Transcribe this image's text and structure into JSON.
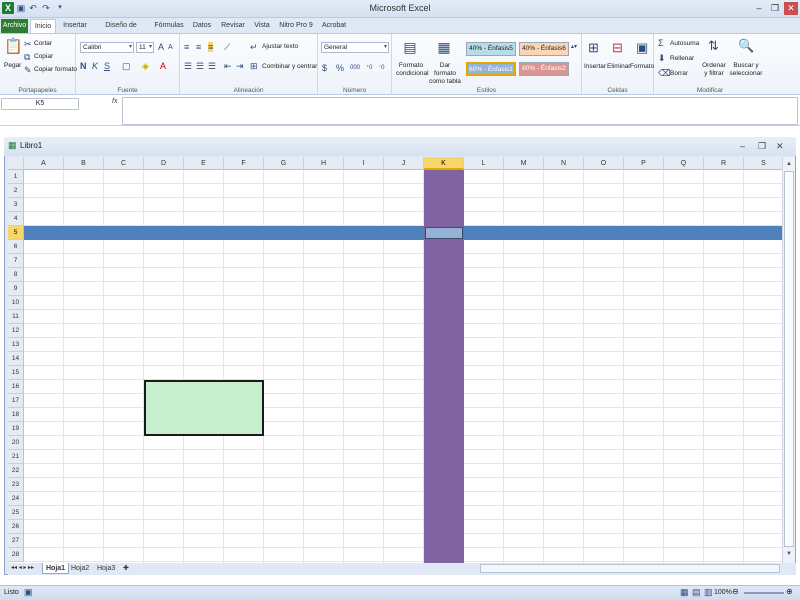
{
  "app": {
    "title": "Microsoft Excel"
  },
  "tabs": [
    "Archivo",
    "Inicio",
    "Insertar",
    "Diseño de página",
    "Fórmulas",
    "Datos",
    "Revisar",
    "Vista",
    "Nitro Pro 9",
    "Acrobat"
  ],
  "ribbon": {
    "clipboard": {
      "paste": "Pegar",
      "cut": "Cortar",
      "copy": "Copiar",
      "format_painter": "Copiar formato",
      "label": "Portapapeles"
    },
    "font": {
      "name": "Calibri",
      "size": "11",
      "label": "Fuente"
    },
    "alignment": {
      "wrap": "Ajustar texto",
      "merge": "Combinar y centrar",
      "label": "Alineación"
    },
    "number": {
      "format": "General",
      "label": "Número"
    },
    "styles": {
      "cond_format": "Formato condicional",
      "table_format": "Dar formato como tabla",
      "s1": "40% - Énfasis5",
      "s2": "40% - Énfasis6",
      "s3": "60% - Énfasis1",
      "s4": "60% - Énfasis2",
      "label": "Estilos"
    },
    "cells": {
      "insert": "Insertar",
      "delete": "Eliminar",
      "format": "Formato",
      "label": "Celdas"
    },
    "editing": {
      "autosum": "Autosuma",
      "fill": "Rellenar",
      "clear": "Borrar",
      "sort": "Ordenar y filtrar",
      "find": "Buscar y seleccionar",
      "label": "Modificar"
    }
  },
  "formula_bar": {
    "name_box": "K5",
    "fx": "fx",
    "value": ""
  },
  "workbook": {
    "title": "Libro1"
  },
  "grid": {
    "columns": [
      "A",
      "B",
      "C",
      "D",
      "E",
      "F",
      "G",
      "H",
      "I",
      "J",
      "K",
      "L",
      "M",
      "N",
      "O",
      "P",
      "Q",
      "R",
      "S"
    ],
    "rows": [
      "1",
      "2",
      "3",
      "4",
      "5",
      "6",
      "7",
      "8",
      "9",
      "10",
      "11",
      "12",
      "13",
      "14",
      "15",
      "16",
      "17",
      "18",
      "19",
      "20",
      "21",
      "22",
      "23",
      "24",
      "25",
      "26",
      "27",
      "28"
    ],
    "selected_column": "K",
    "selected_row": "5",
    "active_cell": "K5",
    "highlight_colors": {
      "column": "#8064a2",
      "row": "#4f81bd",
      "green_box": "#c6efce"
    },
    "green_range": "D16:F19"
  },
  "sheets": [
    "Hoja1",
    "Hoja2",
    "Hoja3"
  ],
  "active_sheet": "Hoja1",
  "status": {
    "mode": "Listo",
    "zoom": "100%"
  }
}
